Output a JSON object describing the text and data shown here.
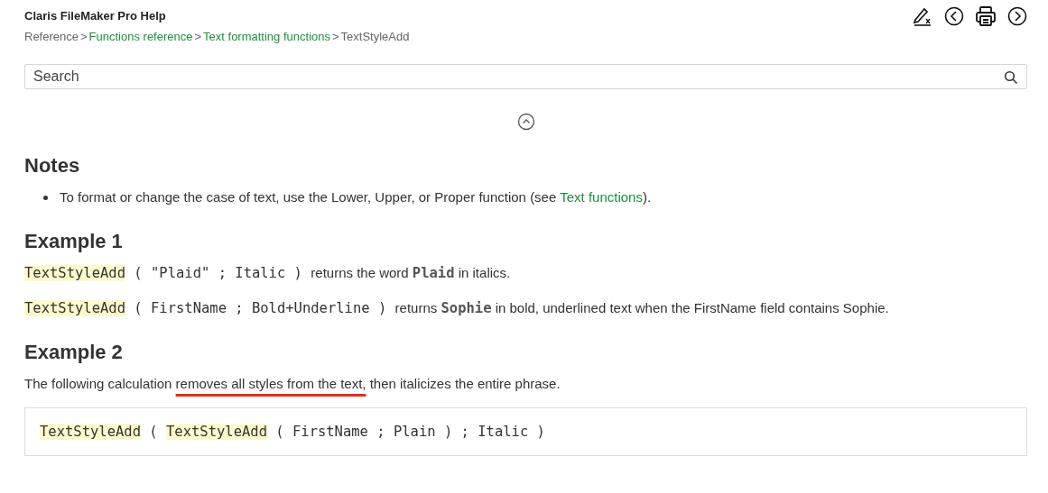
{
  "header": {
    "title": "Claris FileMaker Pro Help",
    "breadcrumb": [
      {
        "label": "Reference",
        "link": false
      },
      {
        "label": "Functions reference",
        "link": true
      },
      {
        "label": "Text formatting functions",
        "link": true
      },
      {
        "label": "TextStyleAdd",
        "link": false
      }
    ],
    "separator": ">"
  },
  "search": {
    "placeholder": "Search"
  },
  "sections": [
    {
      "heading": "Notes",
      "blocks": [
        {
          "kind": "bullet",
          "segments": [
            {
              "kind": "text",
              "text": "To format or change the case of text, use the Lower, Upper, or Proper function (see "
            },
            {
              "kind": "link",
              "text": "Text functions"
            },
            {
              "kind": "text",
              "text": ")."
            }
          ]
        }
      ]
    },
    {
      "heading": "Example 1",
      "blocks": [
        {
          "kind": "para",
          "segments": [
            {
              "kind": "fn",
              "text": "TextStyleAdd"
            },
            {
              "kind": "code",
              "text": " ( \"Plaid\" ; Italic ) "
            },
            {
              "kind": "text",
              "text": "returns the word "
            },
            {
              "kind": "boldcode",
              "text": "Plaid"
            },
            {
              "kind": "text",
              "text": " in italics."
            }
          ]
        },
        {
          "kind": "para",
          "segments": [
            {
              "kind": "fn",
              "text": "TextStyleAdd"
            },
            {
              "kind": "code",
              "text": " ( FirstName ; Bold+Underline ) "
            },
            {
              "kind": "text",
              "text": "returns "
            },
            {
              "kind": "boldcode",
              "text": "Sophie"
            },
            {
              "kind": "text",
              "text": " in bold, underlined text when the FirstName field contains Sophie."
            }
          ]
        }
      ]
    },
    {
      "heading": "Example 2",
      "blocks": [
        {
          "kind": "para",
          "segments": [
            {
              "kind": "text",
              "text": "The following calculation "
            },
            {
              "kind": "marked",
              "text": "removes all styles from the text,"
            },
            {
              "kind": "text",
              "text": " then italicizes the entire phrase."
            }
          ]
        },
        {
          "kind": "codeblock",
          "segments": [
            {
              "kind": "fn",
              "text": "TextStyleAdd"
            },
            {
              "kind": "code",
              "text": " ( "
            },
            {
              "kind": "fn",
              "text": "TextStyleAdd"
            },
            {
              "kind": "code",
              "text": " ( FirstName ; Plain ) ; Italic )"
            }
          ]
        }
      ]
    }
  ]
}
